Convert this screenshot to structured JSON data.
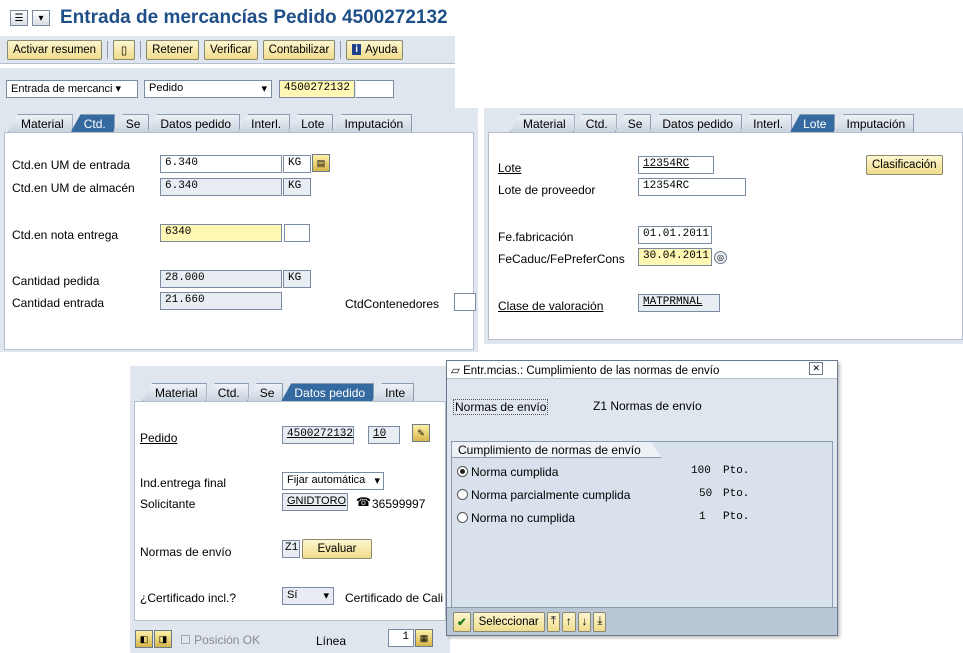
{
  "window": {
    "title": "Entrada de mercancías Pedido 4500272132"
  },
  "toolbar": {
    "activar_resumen": "Activar resumen",
    "retener": "Retener",
    "verificar": "Verificar",
    "contabilizar": "Contabilizar",
    "ayuda": "Ayuda"
  },
  "header_row": {
    "transaction": "Entrada de mercanci",
    "reference_type": "Pedido",
    "document_number": "4500272132"
  },
  "tabs": [
    "Material",
    "Ctd.",
    "Se",
    "Datos pedido",
    "Interl.",
    "Lote",
    "Imputación"
  ],
  "qty_tab": {
    "entrada_label": "Ctd.en UM de entrada",
    "entrada_value": "6.340",
    "entrada_unit": "KG",
    "almacen_label": "Ctd.en UM de almacén",
    "almacen_value": "6.340",
    "almacen_unit": "KG",
    "nota_label": "Ctd.en nota entrega",
    "nota_value": "6340",
    "pedida_label": "Cantidad pedida",
    "pedida_value": "28.000",
    "pedida_unit": "KG",
    "entrada_total_label": "Cantidad entrada",
    "entrada_total_value": "21.660",
    "contenedores_label": "CtdContenedores"
  },
  "batch_tab": {
    "lote_label": "Lote",
    "lote_value": "12354RC",
    "lote_prov_label": "Lote de proveedor",
    "lote_prov_value": "12354RC",
    "clasificacion_button": "Clasificación",
    "fab_label": "Fe.fabricación",
    "fab_value": "01.01.2011",
    "caduc_label": "FeCaduc/FePreferCons",
    "caduc_value": "30.04.2011",
    "valoracion_label": "Clase de valoración",
    "valoracion_value": "MATPRMNAL"
  },
  "po_tab": {
    "pedido_label": "Pedido",
    "pedido_value": "4500272132",
    "pedido_pos": "10",
    "ind_label": "Ind.entrega final",
    "ind_value": "Fijar automática",
    "solicitante_label": "Solicitante",
    "solicitante_value": "GNIDTORO",
    "phone": "36599997",
    "normas_label": "Normas de envío",
    "normas_value": "Z1",
    "evaluar_button": "Evaluar",
    "cert_label": "¿Certificado incl.?",
    "cert_value": "Sí",
    "cert_cali_label": "Certificado de Cali",
    "posicion_ok": "Posición OK",
    "linea_label": "Línea",
    "linea_value": "1"
  },
  "tabs_short": [
    "Material",
    "Ctd.",
    "Se",
    "Datos pedido",
    "Inte"
  ],
  "dialog": {
    "title": "Entr.mcias.: Cumplimiento de las normas de envío",
    "normas_label": "Normas de envío",
    "normas_value": "Z1  Normas de envío",
    "group_title": "Cumplimiento de normas de envío",
    "options": [
      {
        "label": "Norma cumplida",
        "points": "100",
        "unit": "Pto."
      },
      {
        "label": "Norma parcialmente cumplida",
        "points": "50",
        "unit": "Pto."
      },
      {
        "label": "Norma no cumplida",
        "points": "1",
        "unit": "Pto."
      }
    ],
    "selected_index": 0,
    "seleccionar_button": "Seleccionar"
  }
}
